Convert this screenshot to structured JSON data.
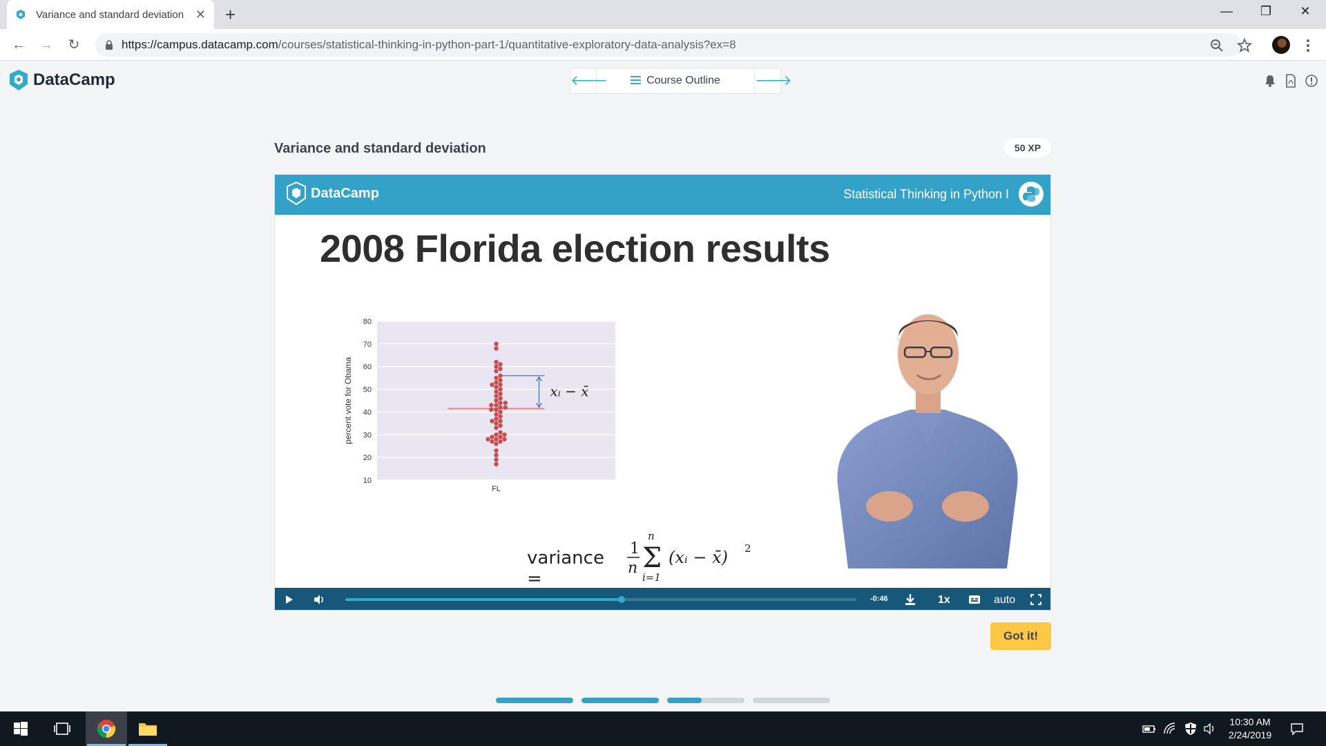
{
  "browser": {
    "tab_title": "Variance and standard deviation",
    "url_host": "https://campus.datacamp.com",
    "url_path": "/courses/statistical-thinking-in-python-part-1/quantitative-exploratory-data-analysis?ex=8"
  },
  "header": {
    "brand": "DataCamp",
    "course_outline_label": "Course Outline"
  },
  "exercise": {
    "title": "Variance and standard deviation",
    "xp": "50 XP",
    "got_it_label": "Got it!",
    "step_progress": [
      1,
      1,
      0.45,
      0
    ]
  },
  "slide": {
    "brand": "DataCamp",
    "course_name": "Statistical Thinking in Python I",
    "heading": "2008 Florida election results",
    "formula_lhs": "variance =",
    "annotation": "xᵢ − x̄"
  },
  "video": {
    "progress": 0.54,
    "time_remaining": "-0:46",
    "speed": "1x",
    "quality": "auto"
  },
  "chart_data": {
    "type": "scatter",
    "categories": [
      "FL"
    ],
    "ylabel": "percent vote for Obama",
    "ylim": [
      10,
      80
    ],
    "yticks": [
      10,
      20,
      30,
      40,
      50,
      60,
      70,
      80
    ],
    "mean": 41.5,
    "highlight_value": 56,
    "values": [
      17,
      19,
      21,
      23,
      26,
      27,
      27,
      28,
      28,
      28,
      29,
      29,
      30,
      30,
      31,
      33,
      34,
      35,
      36,
      36,
      37,
      38,
      39,
      40,
      41,
      41,
      42,
      42,
      43,
      43,
      44,
      44,
      45,
      46,
      47,
      48,
      49,
      50,
      51,
      52,
      52,
      53,
      54,
      55,
      56,
      58,
      59,
      60,
      61,
      62,
      68,
      70
    ]
  },
  "taskbar": {
    "time": "10:30 AM",
    "date": "2/24/2019"
  }
}
